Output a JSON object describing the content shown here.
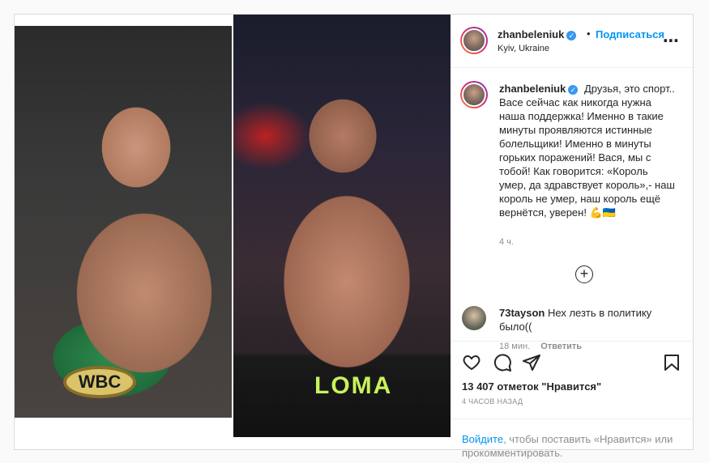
{
  "header": {
    "username": "zhanbeleniuk",
    "follow_label": "Подписаться",
    "location": "Kyiv, Ukraine",
    "more_icon": "more-horizontal-icon"
  },
  "media": {
    "left_belt_text": "WBC",
    "right_trunks_text": "LOMA"
  },
  "caption": {
    "username": "zhanbeleniuk",
    "text": "Друзья, это спорт.. Васе сейчас как никогда нужна наша поддержка! Именно в такие минуты проявляются истинные болельщики! Именно в минуты горьких поражений! Вася, мы с тобой! Как говорится: «Король умер, да здравствует король»,- наш король не умер, наш король ещё вернётся, уверен! 💪🇺🇦",
    "time_ago": "4 ч."
  },
  "comment": {
    "username": "73tayson",
    "text": "Нех лезть в политику было((",
    "time_ago": "18 мин.",
    "reply_label": "Ответить"
  },
  "actions": {
    "likes": "13 407 отметок \"Нравится\"",
    "posted": "4 ЧАСОВ НАЗАД"
  },
  "login": {
    "link_label": "Войдите",
    "text": ", чтобы поставить «Нравится» или прокомментировать."
  },
  "colors": {
    "accent": "#0095f6",
    "verified": "#3897f0",
    "muted": "#8e8e8e"
  }
}
